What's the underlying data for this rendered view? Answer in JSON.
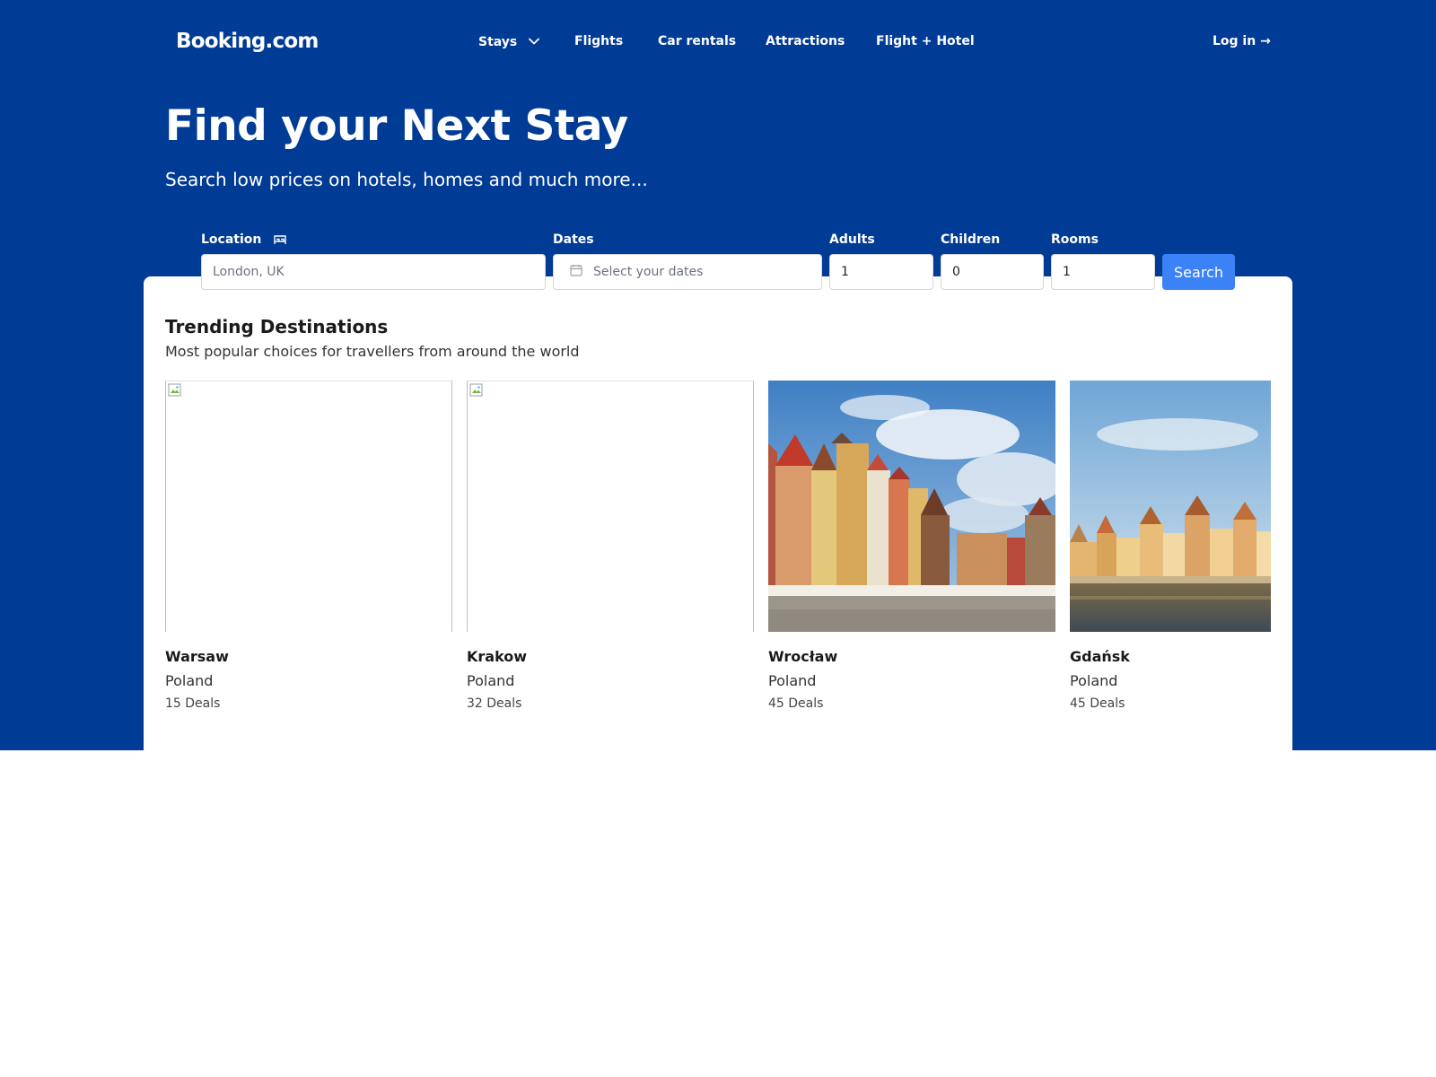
{
  "brand": {
    "logo": "Booking.com"
  },
  "nav": {
    "items": [
      {
        "label": "Stays",
        "has_dropdown": true,
        "icon": "chevron-down-icon"
      },
      {
        "label": "Flights"
      },
      {
        "label": "Car rentals"
      },
      {
        "label": "Attractions"
      },
      {
        "label": "Flight + Hotel"
      }
    ],
    "login_label": "Log in →"
  },
  "hero": {
    "title": "Find your Next Stay",
    "subtitle": "Search low prices on hotels, homes and much more..."
  },
  "search": {
    "location": {
      "label": "Location",
      "icon": "bed-icon",
      "placeholder": "London, UK"
    },
    "dates": {
      "label": "Dates",
      "icon": "calendar-icon",
      "placeholder": "Select your dates"
    },
    "adults": {
      "label": "Adults",
      "value": "1"
    },
    "children": {
      "label": "Children",
      "value": "0"
    },
    "rooms": {
      "label": "Rooms",
      "value": "1"
    },
    "button_label": "Search"
  },
  "trending": {
    "title": "Trending Destinations",
    "subtitle": "Most popular choices for travellers from around the world",
    "cards": [
      {
        "city": "Warsaw",
        "country": "Poland",
        "deals": "15 Deals",
        "image": "broken-image-icon"
      },
      {
        "city": "Krakow",
        "country": "Poland",
        "deals": "32 Deals",
        "image": "broken-image-icon"
      },
      {
        "city": "Wrocław",
        "country": "Poland",
        "deals": "45 Deals",
        "image": "wroclaw-market-square-photo"
      },
      {
        "city": "Gdańsk",
        "country": "Poland",
        "deals": "45 Deals",
        "image": "gdansk-riverside-photo"
      }
    ]
  },
  "colors": {
    "brand_blue": "#003b95",
    "search_button": "#3b82f6",
    "white": "#ffffff"
  }
}
